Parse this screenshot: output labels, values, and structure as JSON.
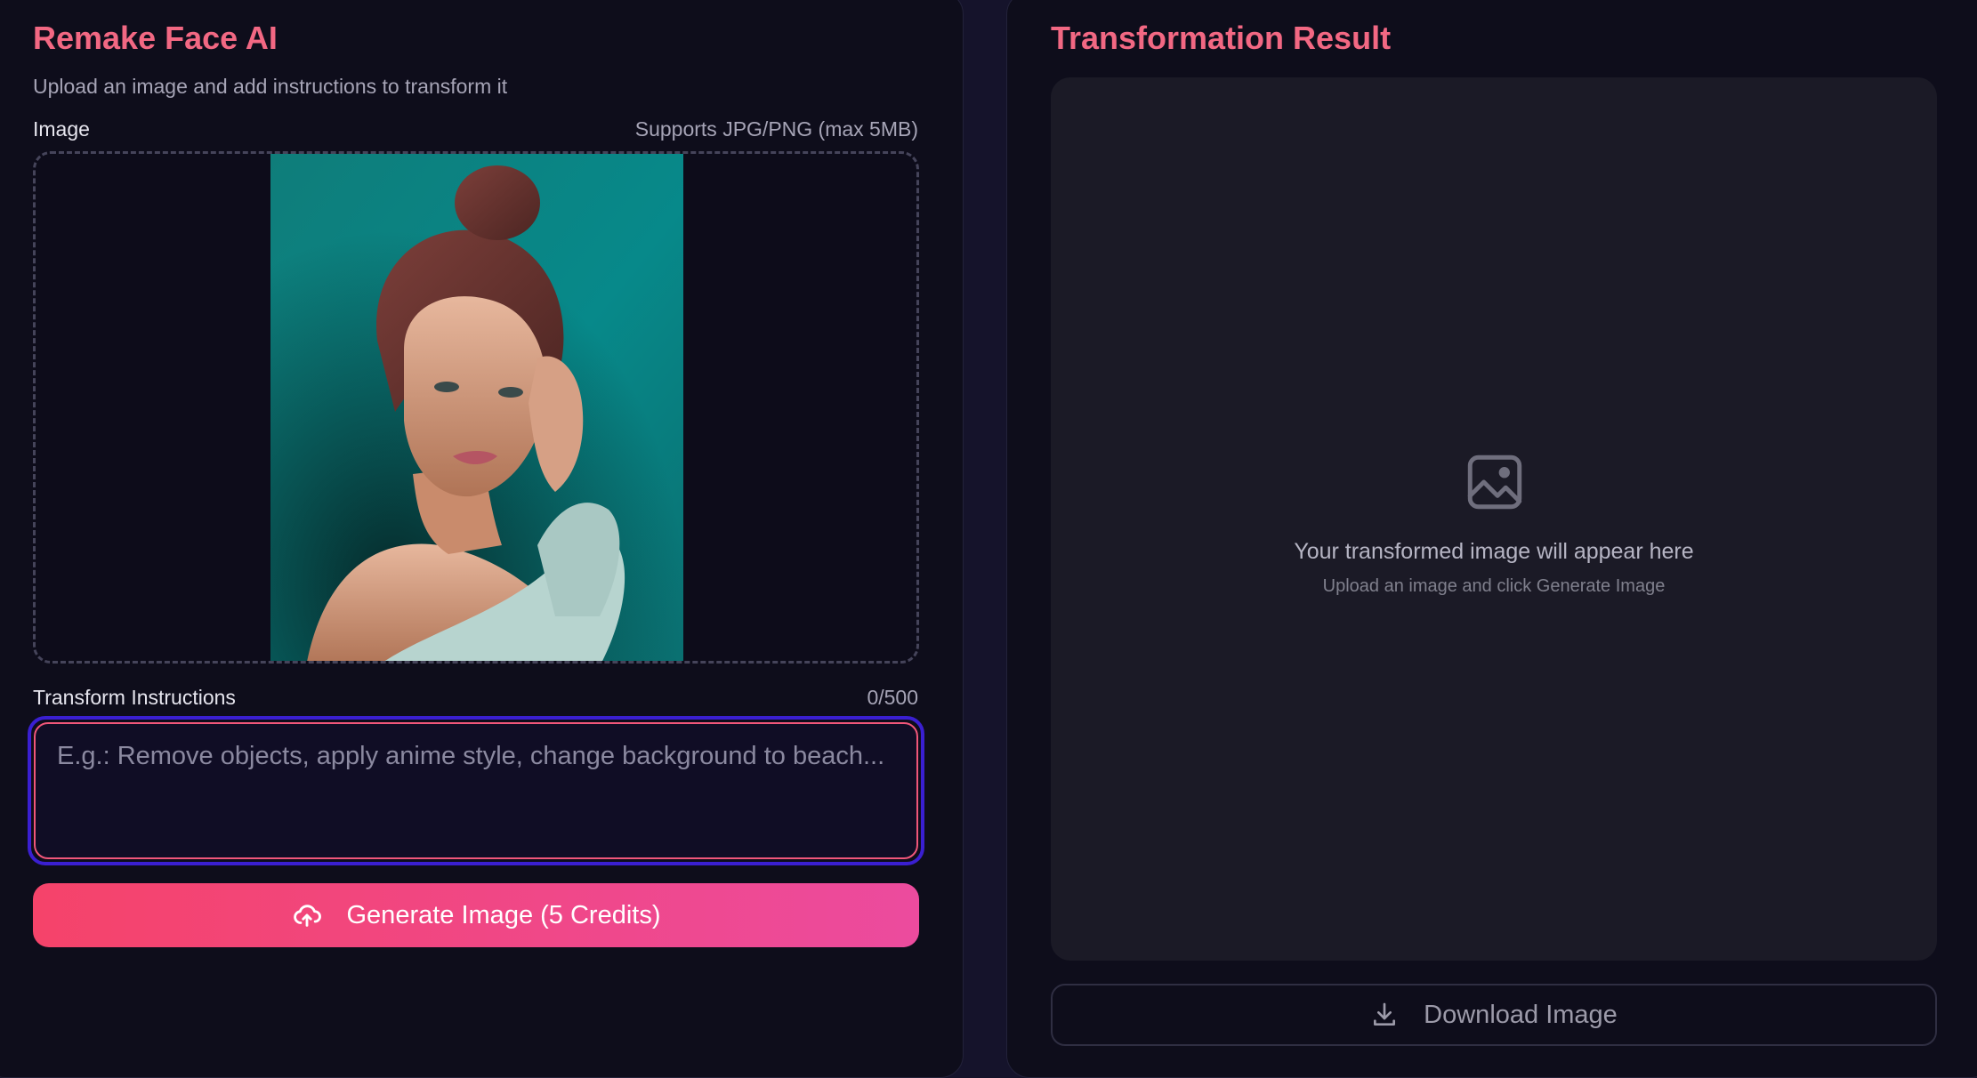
{
  "left_panel": {
    "title": "Remake Face AI",
    "subtitle": "Upload an image and add instructions to transform it",
    "image_label": "Image",
    "image_hint": "Supports JPG/PNG (max 5MB)",
    "uploaded_image_icon": "portrait-photo",
    "instructions_label": "Transform Instructions",
    "char_count": "0/500",
    "instructions_value": "",
    "instructions_placeholder": "E.g.: Remove objects, apply anime style, change background to beach...",
    "generate_label": "Generate Image (5 Credits)",
    "generate_icon": "cloud-upload-icon"
  },
  "right_panel": {
    "title": "Transformation Result",
    "placeholder_icon": "image-icon",
    "empty_message": "Your transformed image will appear here",
    "empty_hint": "Upload an image and click Generate Image",
    "download_label": "Download Image",
    "download_icon": "download-icon"
  },
  "colors": {
    "accent": "#f26883",
    "button_gradient_start": "#f5436a",
    "button_gradient_end": "#ec4b9e",
    "focus_ring": "#3a1fd1",
    "panel_bg": "#0e0d1b"
  }
}
